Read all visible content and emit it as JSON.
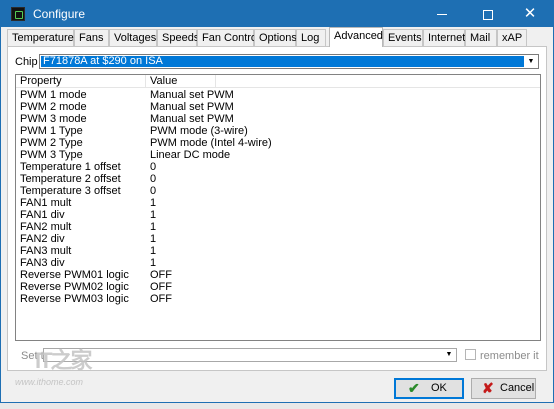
{
  "window": {
    "title": "Configure",
    "controls": {
      "minimize": "—",
      "maximize": "□",
      "close": "✕"
    }
  },
  "tabs": [
    {
      "label": "Temperatures",
      "active": false
    },
    {
      "label": "Fans",
      "active": false
    },
    {
      "label": "Voltages",
      "active": false
    },
    {
      "label": "Speeds",
      "active": false
    },
    {
      "label": "Fan Control",
      "active": false
    },
    {
      "label": "Options",
      "active": false
    },
    {
      "label": "Log",
      "active": false
    },
    {
      "label": "Advanced",
      "active": true
    },
    {
      "label": "Events",
      "active": false
    },
    {
      "label": "Internet",
      "active": false
    },
    {
      "label": "Mail",
      "active": false
    },
    {
      "label": "xAP",
      "active": false
    }
  ],
  "chip": {
    "label": "Chip",
    "value": "F71878A at $290 on ISA"
  },
  "list": {
    "headers": {
      "property": "Property",
      "value": "Value"
    },
    "rows": [
      {
        "property": "PWM 1 mode",
        "value": "Manual set PWM"
      },
      {
        "property": "PWM 2 mode",
        "value": "Manual set PWM"
      },
      {
        "property": "PWM 3 mode",
        "value": "Manual set PWM"
      },
      {
        "property": "PWM 1 Type",
        "value": "PWM mode (3-wire)"
      },
      {
        "property": "PWM 2 Type",
        "value": "PWM mode (Intel 4-wire)"
      },
      {
        "property": "PWM 3 Type",
        "value": "Linear DC mode"
      },
      {
        "property": "Temperature 1 offset",
        "value": "0"
      },
      {
        "property": "Temperature 2 offset",
        "value": "0"
      },
      {
        "property": "Temperature 3 offset",
        "value": "0"
      },
      {
        "property": "FAN1 mult",
        "value": "1"
      },
      {
        "property": "FAN1 div",
        "value": "1"
      },
      {
        "property": "FAN2 mult",
        "value": "1"
      },
      {
        "property": "FAN2 div",
        "value": "1"
      },
      {
        "property": "FAN3 mult",
        "value": "1"
      },
      {
        "property": "FAN3 div",
        "value": "1"
      },
      {
        "property": "Reverse PWM01 logic",
        "value": "OFF"
      },
      {
        "property": "Reverse PWM02 logic",
        "value": "OFF"
      },
      {
        "property": "Reverse PWM03 logic",
        "value": "OFF"
      }
    ]
  },
  "set_to": {
    "label": "Set to",
    "value": "",
    "remember_label": "remember it",
    "remember_checked": false
  },
  "buttons": {
    "ok": "OK",
    "cancel": "Cancel"
  },
  "watermark": {
    "logo": "IT之家",
    "url": "www.ithome.com"
  },
  "colors": {
    "titlebar": "#1e6fb3",
    "selection": "#0078d7",
    "ok_icon": "#2a8a2a",
    "cancel_icon": "#c41a1a"
  },
  "icons": {
    "app": "app-icon",
    "ok": "checkmark-icon",
    "cancel": "x-icon",
    "dropdown": "chevron-down-icon"
  }
}
